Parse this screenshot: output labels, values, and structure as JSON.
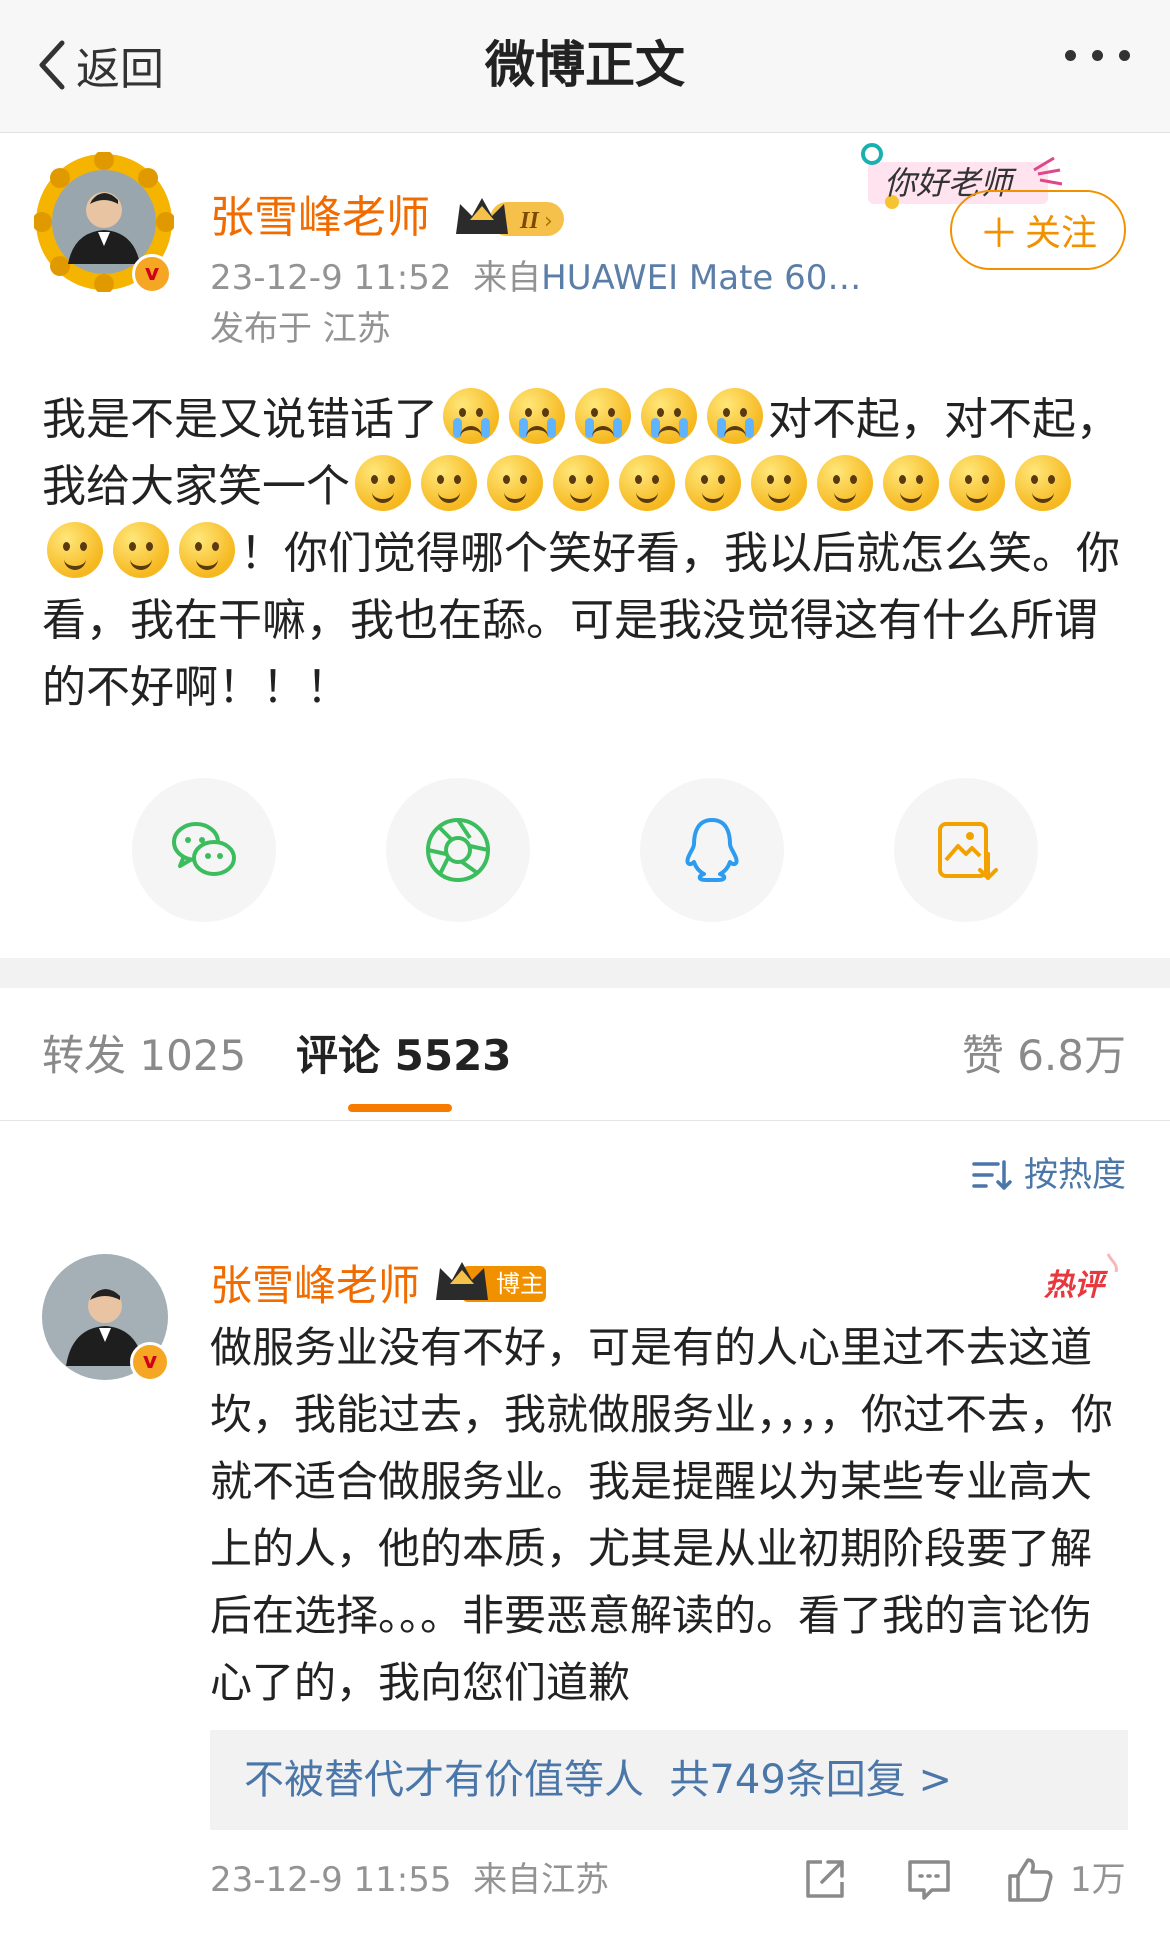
{
  "nav": {
    "back_label": "返回",
    "title": "微博正文"
  },
  "post": {
    "author": "张雪峰老师",
    "timestamp": "23-12-9 11:52",
    "source_prefix": "来自",
    "device": "HUAWEI Mate 60…",
    "location": "发布于 江苏",
    "follow_label": "关注",
    "sticker_text": "你好老师",
    "text": {
      "p1": "我是不是又说错话了",
      "p2": "对不起，对不起，我给大家笑一个",
      "p3": "！你们觉得哪个笑好看，我以后就怎么笑。你看，我在干嘛，我也在舔。可是我没觉得这有什么所谓的不好啊！！！"
    }
  },
  "share": [
    "wechat-icon",
    "moments-icon",
    "qq-icon",
    "save-image-icon"
  ],
  "tabs": {
    "repost": "转发 1025",
    "comments": "评论 5523",
    "likes": "赞 6.8万"
  },
  "sort_label": "按热度",
  "comment": {
    "author": "张雪峰老师",
    "author_tag": "博主",
    "hot_tag": "热评",
    "text": "做服务业没有不好，可是有的人心里过不去这道坎，我能过去，我就做服务业，，，，你过不去，你就不适合做服务业。我是提醒以为某些专业高大上的人，他的本质，尤其是从业初期阶段要了解后在选择。。。非要恶意解读的。看了我的言论伤心了的，我向您们道歉",
    "reply_user": "不被替代才有价值",
    "reply_mid": "等人",
    "reply_count": "共749条回复 >",
    "timestamp": "23-12-9 11:55",
    "location": "来自江苏",
    "like_count": "1万"
  },
  "colors": {
    "accent_orange": "#f06c00",
    "link_blue": "#4a76a8",
    "tab_underline": "#f77b00"
  }
}
